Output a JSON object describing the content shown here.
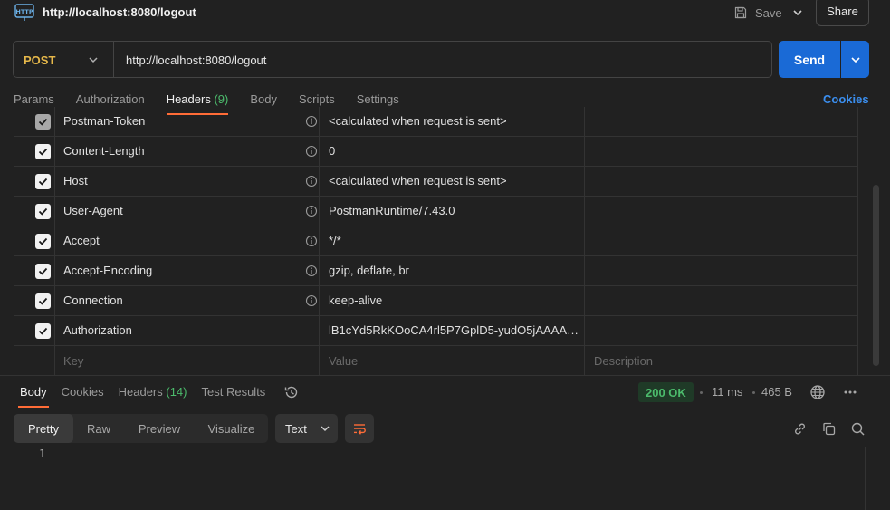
{
  "header": {
    "title": "http://localhost:8080/logout",
    "save_label": "Save",
    "share_label": "Share"
  },
  "request": {
    "method": "POST",
    "url": "http://localhost:8080/logout",
    "send_label": "Send"
  },
  "request_tabs": {
    "params": "Params",
    "authorization": "Authorization",
    "headers": "Headers",
    "headers_count": "(9)",
    "body": "Body",
    "scripts": "Scripts",
    "settings": "Settings",
    "cookies": "Cookies"
  },
  "headers_table": {
    "rows": [
      {
        "key": "Postman-Token",
        "value": "<calculated when request is sent>",
        "checked": true,
        "disabled": true
      },
      {
        "key": "Content-Length",
        "value": "0",
        "checked": true
      },
      {
        "key": "Host",
        "value": "<calculated when request is sent>",
        "checked": true
      },
      {
        "key": "User-Agent",
        "value": "PostmanRuntime/7.43.0",
        "checked": true
      },
      {
        "key": "Accept",
        "value": "*/*",
        "checked": true
      },
      {
        "key": "Accept-Encoding",
        "value": "gzip, deflate, br",
        "checked": true
      },
      {
        "key": "Connection",
        "value": "keep-alive",
        "checked": true
      },
      {
        "key": "Authorization",
        "value": "lB1cYd5RkKOoCA4rl5P7GplD5-yudO5jAAAAAQ...",
        "checked": true
      }
    ],
    "placeholders": {
      "key": "Key",
      "value": "Value",
      "description": "Description"
    }
  },
  "response": {
    "tabs": {
      "body": "Body",
      "cookies": "Cookies",
      "headers": "Headers",
      "headers_count": "(14)",
      "test_results": "Test Results"
    },
    "status": "200 OK",
    "time": "11 ms",
    "size": "465 B",
    "views": {
      "pretty": "Pretty",
      "raw": "Raw",
      "preview": "Preview",
      "visualize": "Visualize"
    },
    "format": "Text",
    "line_number": "1"
  },
  "colors": {
    "accent": "#ff6c37",
    "send": "#1a6ad6",
    "status_ok": "#4cbb6c",
    "method_post": "#e6b84a"
  }
}
